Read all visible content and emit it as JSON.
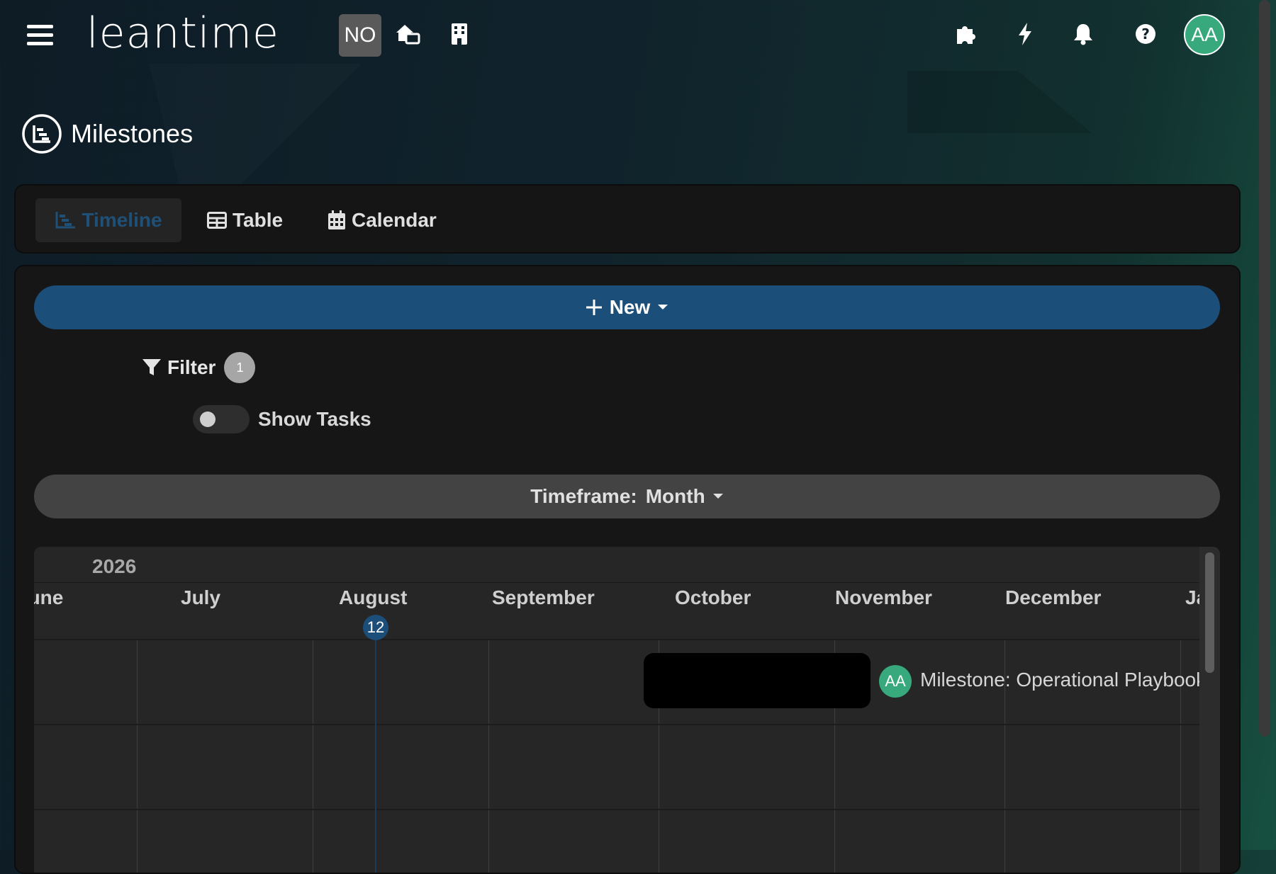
{
  "header": {
    "logo_text": "leantime",
    "project_badge": "NO",
    "icons": [
      "menu-icon",
      "home-switch-icon",
      "building-icon",
      "puzzle-icon",
      "lightning-icon",
      "bell-icon",
      "help-icon"
    ],
    "user_initials": "AA"
  },
  "page": {
    "title": "Milestones"
  },
  "tabs": [
    {
      "label": "Timeline",
      "active": true
    },
    {
      "label": "Table",
      "active": false
    },
    {
      "label": "Calendar",
      "active": false
    }
  ],
  "toolbar": {
    "new_label": "New",
    "filter_label": "Filter",
    "filter_count": "1",
    "show_tasks_label": "Show Tasks",
    "timeframe_label": "Timeframe:",
    "timeframe_value": "Month"
  },
  "gantt": {
    "year": "2026",
    "months": [
      "June",
      "July",
      "August",
      "September",
      "October",
      "November",
      "December",
      "January"
    ],
    "today_day": "12",
    "milestone_label": "Milestone: Operational Playbook",
    "milestone_owner": "AA"
  },
  "colors": {
    "accent": "#1c4e7a",
    "avatar": "#37a97d",
    "panel": "#161616"
  }
}
